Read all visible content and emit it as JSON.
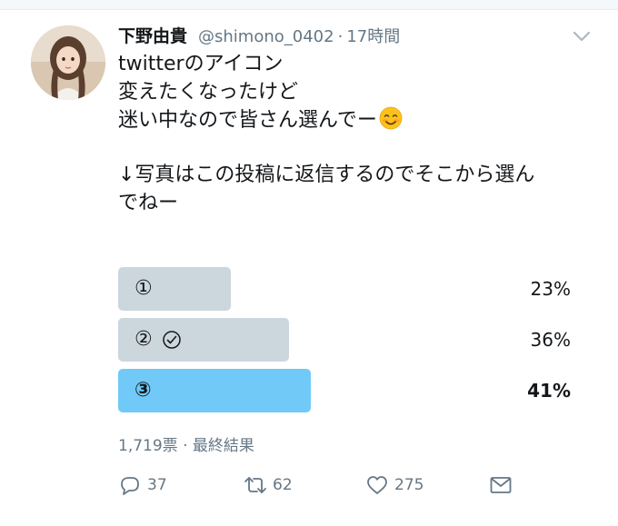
{
  "tweet": {
    "display_name": "下野由貴",
    "handle": "@shimono_0402",
    "separator": "·",
    "time": "17時間",
    "text_lines": [
      "twitterのアイコン",
      "変えたくなったけど",
      "迷い中なので皆さん選んでー",
      "",
      "↓写真はこの投稿に返信するのでそこから選ん",
      "でねー"
    ],
    "emoji": "smiling-face-emoji"
  },
  "poll": {
    "options": [
      {
        "label": "①",
        "percent_text": "23%",
        "value": 23,
        "selected": false,
        "winner": false
      },
      {
        "label": "②",
        "percent_text": "36%",
        "value": 36,
        "selected": true,
        "winner": false
      },
      {
        "label": "③",
        "percent_text": "41%",
        "value": 41,
        "selected": false,
        "winner": true
      }
    ],
    "meta": "1,719票 · 最終結果",
    "colors": {
      "bar": "#ccd6dd",
      "winner_bar": "#71c9f8"
    }
  },
  "actions": {
    "reply_count": "37",
    "retweet_count": "62",
    "like_count": "275"
  }
}
